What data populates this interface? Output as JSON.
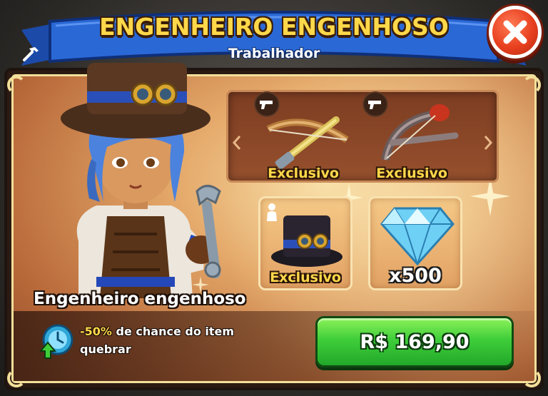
{
  "header": {
    "title": "ENGENHEIRO ENGENHOSO",
    "subtitle": "Trabalhador",
    "subtitle_icon": "hammer-icon",
    "close_icon": "close-icon"
  },
  "hero": {
    "name": "Engenheiro engenhoso",
    "perk": {
      "icon": "clock-arrow-up-icon",
      "value": "-50%",
      "text_line1": "de chance do item",
      "text_line2": "quebrar"
    }
  },
  "items": {
    "weapon_1": {
      "label": "Exclusivo",
      "type_icon": "pistol-icon",
      "art": "crossbow"
    },
    "weapon_2": {
      "label": "Exclusivo",
      "type_icon": "pistol-icon",
      "art": "crossbow-dark"
    },
    "hat": {
      "label": "Exclusivo",
      "type_icon": "person-icon",
      "art": "steampunk-top-hat"
    },
    "gems": {
      "amount": "x500",
      "art": "diamond-gem"
    }
  },
  "purchase": {
    "price_label": "R$ 169,90"
  },
  "colors": {
    "title_yellow": "#ffd84a",
    "ribbon_blue": "#2a68d6",
    "buy_green": "#3fce3a",
    "close_red": "#e8401f"
  }
}
